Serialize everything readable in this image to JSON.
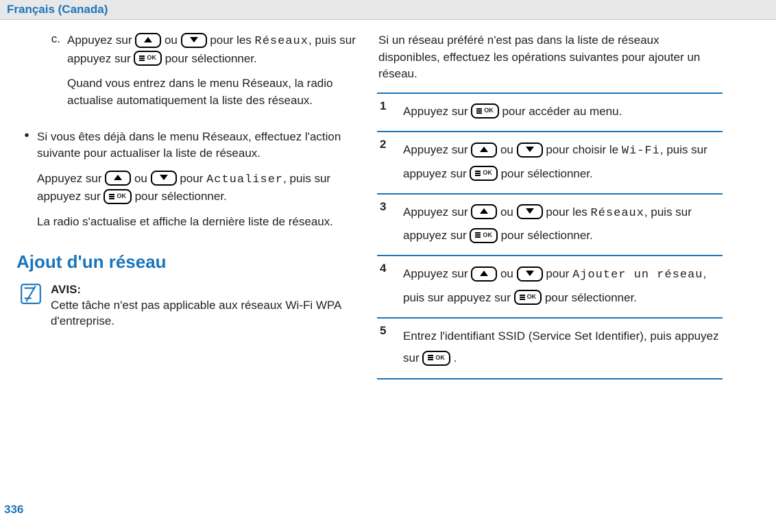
{
  "header": "Français (Canada)",
  "page_number": "336",
  "col1": {
    "c_marker": "c.",
    "c_l1a": "Appuyez sur ",
    "c_l1b": " ou ",
    "c_l1c": " pour les ",
    "c_l1_mono": "Réseaux",
    "c_l1d": ", puis sur appuyez sur ",
    "c_l1e": " pour sélectionner.",
    "c_p2": "Quand vous entrez dans le menu Réseaux, la radio actualise automatiquement la liste des réseaux.",
    "b1_p1": "Si vous êtes déjà dans le menu Réseaux, effectuez l'action suivante pour actualiser la liste de réseaux.",
    "b1_l2a": "Appuyez sur ",
    "b1_l2b": " ou ",
    "b1_l2c": " pour ",
    "b1_l2_mono": "Actualiser",
    "b1_l2d": ", puis sur appuyez sur ",
    "b1_l2e": " pour sélectionner.",
    "b1_p3": "La radio s'actualise et affiche la dernière liste de réseaux.",
    "heading": "Ajout d'un réseau",
    "notice_title": "AVIS:",
    "notice_body": "Cette tâche n'est pas applicable aux réseaux Wi-Fi WPA d'entreprise."
  },
  "col2": {
    "intro": "Si un réseau préféré n'est pas dans la liste de réseaux disponibles, effectuez les opérations suivantes pour ajouter un réseau.",
    "steps": {
      "s1": {
        "n": "1",
        "a": "Appuyez sur ",
        "b": " pour accéder au menu."
      },
      "s2": {
        "n": "2",
        "a": "Appuyez sur ",
        "b": " ou ",
        "c": " pour choisir le ",
        "mono": "Wi-Fi",
        "d": ", puis sur appuyez sur ",
        "e": " pour sélectionner."
      },
      "s3": {
        "n": "3",
        "a": "Appuyez sur ",
        "b": " ou ",
        "c": " pour les ",
        "mono": "Réseaux",
        "d": ", puis sur appuyez sur ",
        "e": " pour sélectionner."
      },
      "s4": {
        "n": "4",
        "a": "Appuyez sur ",
        "b": " ou ",
        "c": " pour ",
        "mono": "Ajouter un réseau",
        "d": ", puis sur appuyez sur ",
        "e": " pour sélectionner."
      },
      "s5": {
        "n": "5",
        "a": "Entrez l'identifiant SSID (Service Set Identifier), puis appuyez sur ",
        "b": " ."
      }
    }
  }
}
